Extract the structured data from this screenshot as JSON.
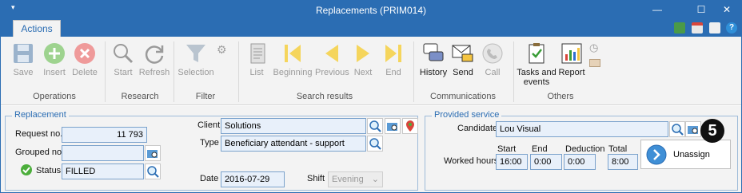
{
  "window": {
    "title": "Replacements (PRIM014)"
  },
  "tabs": {
    "actions": "Actions"
  },
  "ribbon": {
    "operations": {
      "label": "Operations",
      "save": "Save",
      "insert": "Insert",
      "delete": "Delete"
    },
    "research": {
      "label": "Research",
      "start": "Start",
      "refresh": "Refresh"
    },
    "filter": {
      "label": "Filter",
      "selection": "Selection"
    },
    "search_results": {
      "label": "Search results",
      "list": "List",
      "beginning": "Beginning",
      "previous": "Previous",
      "next": "Next",
      "end": "End"
    },
    "communications": {
      "label": "Communications",
      "history": "History",
      "send": "Send",
      "call": "Call"
    },
    "others": {
      "label": "Others",
      "tasks1": "Tasks and",
      "tasks2": "events",
      "report": "Report"
    }
  },
  "replacement": {
    "legend": "Replacement",
    "request_no_label": "Request no.",
    "request_no": "11 793",
    "grouped_no_label": "Grouped no.",
    "grouped_no": "",
    "status_label": "Status",
    "status": "FILLED",
    "client_label": "Client",
    "client": "Solutions",
    "type_label": "Type",
    "type": "Beneficiary attendant - support",
    "date_label": "Date",
    "date": "2016-07-29",
    "shift_label": "Shift",
    "shift": "Evening"
  },
  "provided_service": {
    "legend": "Provided service",
    "candidate_label": "Candidate",
    "candidate": "Lou Visual",
    "worked_hours_label": "Worked hours",
    "start_label": "Start",
    "start": "16:00",
    "end_label": "End",
    "end": "0:00",
    "deduction_label": "Deduction",
    "deduction": "0:00",
    "total_label": "Total",
    "total": "8:00",
    "unassign": "Unassign"
  },
  "callout": "5",
  "colors": {
    "accent": "#2b6db3",
    "field_bg": "#e8f0fa",
    "field_border": "#7ba2cc",
    "status_ok": "#4cae3b",
    "callout": "#111111"
  }
}
